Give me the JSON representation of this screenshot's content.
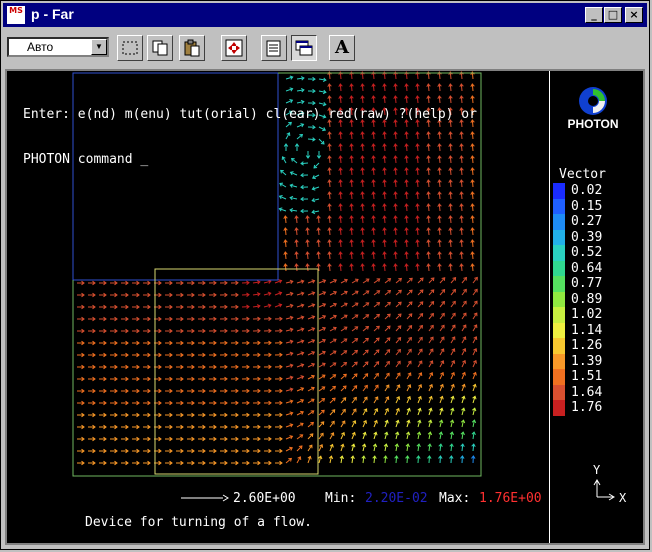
{
  "window": {
    "icon_text": "MS",
    "title": "p - Far",
    "controls": {
      "minimize": "_",
      "maximize": "□",
      "close": "×"
    }
  },
  "toolbar": {
    "font_combo": {
      "value": "Авто"
    },
    "buttons": [
      {
        "name": "mark-button",
        "icon": "dotted-rect-icon"
      },
      {
        "name": "copy-button",
        "icon": "copy-icon"
      },
      {
        "name": "paste-button",
        "icon": "paste-icon"
      },
      {
        "name": "fullscreen-button",
        "icon": "fullscreen-icon"
      },
      {
        "name": "properties-button",
        "icon": "properties-icon"
      },
      {
        "name": "background-button",
        "icon": "window-icon"
      },
      {
        "name": "font-button",
        "icon": "letter-a-icon",
        "label": "A"
      }
    ]
  },
  "console": {
    "line1": "Enter: e(nd) m(enu) tut(orial) cl(ear) red(raw) ?(help) or",
    "line2": "PHOTON command _"
  },
  "logo": {
    "text": "PHOTON"
  },
  "legend": {
    "title": "Vector",
    "values": [
      "0.02",
      "0.15",
      "0.27",
      "0.39",
      "0.52",
      "0.64",
      "0.77",
      "0.89",
      "1.02",
      "1.14",
      "1.26",
      "1.39",
      "1.51",
      "1.64",
      "1.76"
    ],
    "colors": [
      "#1a2cff",
      "#1f5fff",
      "#1e8cf5",
      "#22b0e8",
      "#2ad0c0",
      "#30d890",
      "#55e060",
      "#90e840",
      "#c8f040",
      "#f0f040",
      "#f8c830",
      "#f89828",
      "#f07020",
      "#d85030",
      "#c82020"
    ]
  },
  "bottom": {
    "scale_value": "2.60E+00",
    "min_label": "Min:",
    "min_value": "2.20E-02",
    "max_label": "Max:",
    "max_value": "1.76E+00"
  },
  "caption": "Device for turning of a flow.",
  "axes": {
    "y": "Y",
    "x": "X"
  },
  "colors": {
    "min_value": "#2020c0",
    "max_value": "#ff3030",
    "title_bar": "#000080"
  }
}
